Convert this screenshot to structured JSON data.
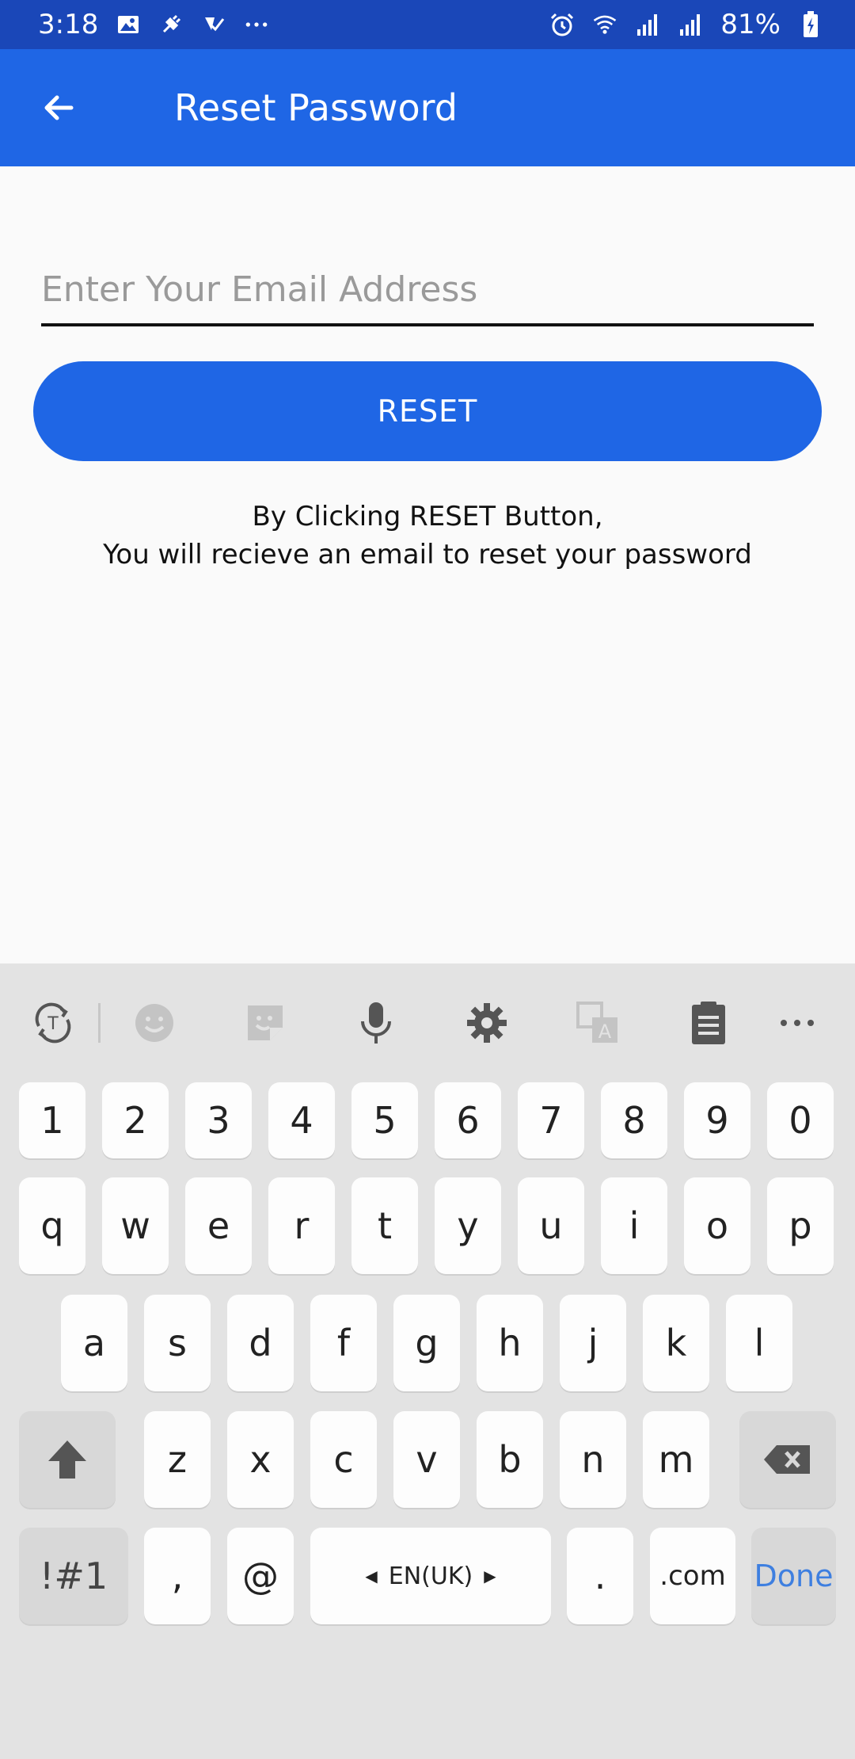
{
  "status_bar": {
    "time": "3:18",
    "battery": "81%"
  },
  "app_bar": {
    "title": "Reset Password"
  },
  "form": {
    "email_placeholder": "Enter Your Email Address",
    "reset_label": "RESET",
    "helper_line1": "By Clicking RESET Button,",
    "helper_line2": "You will recieve an email to reset your password"
  },
  "keyboard": {
    "row1": [
      "1",
      "2",
      "3",
      "4",
      "5",
      "6",
      "7",
      "8",
      "9",
      "0"
    ],
    "row2": [
      "q",
      "w",
      "e",
      "r",
      "t",
      "y",
      "u",
      "i",
      "o",
      "p"
    ],
    "row3": [
      "a",
      "s",
      "d",
      "f",
      "g",
      "h",
      "j",
      "k",
      "l"
    ],
    "row4": [
      "z",
      "x",
      "c",
      "v",
      "b",
      "n",
      "m"
    ],
    "symbols": "!#1",
    "comma": ",",
    "at": "@",
    "language": "EN(UK)",
    "period": ".",
    "dotcom": ".com",
    "done": "Done"
  },
  "colors": {
    "app_bar": "#1f66e5",
    "status_bar": "#1a47b8",
    "done_text": "#3e7fe0"
  }
}
